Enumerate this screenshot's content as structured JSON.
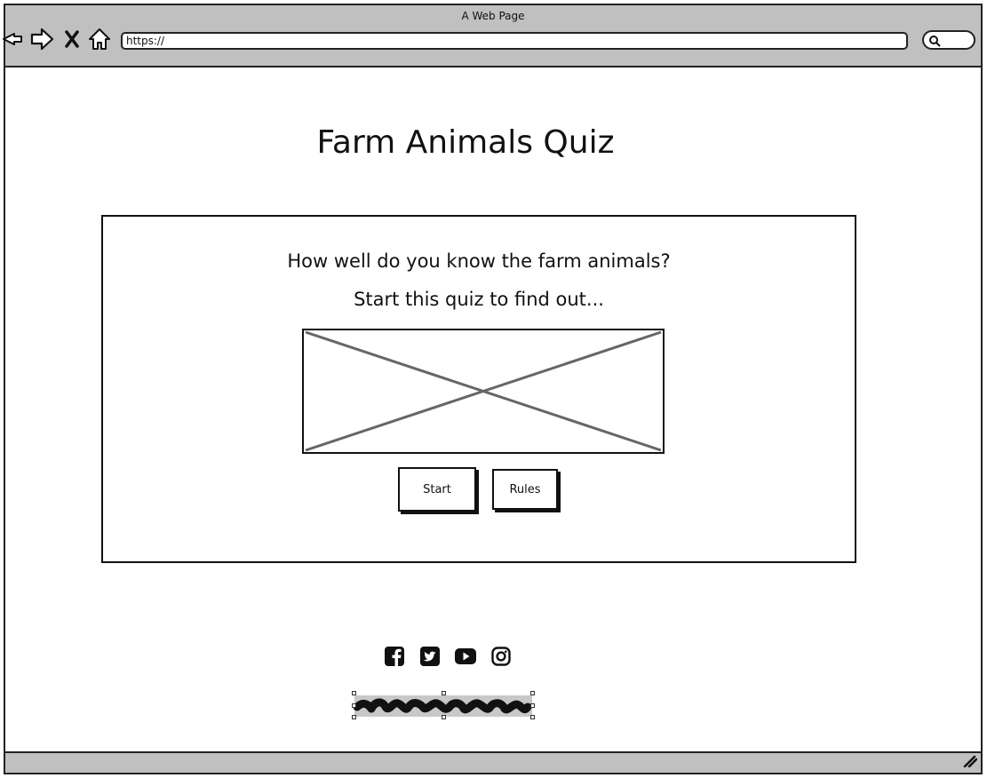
{
  "window": {
    "title": "A Web Page"
  },
  "browser": {
    "url": "https://",
    "icons": [
      "back-arrow-icon",
      "forward-arrow-icon",
      "close-icon",
      "home-icon",
      "search-icon",
      "resize-grip-icon"
    ]
  },
  "page": {
    "title": "Farm Animals Quiz",
    "question": "How well do you know the farm animals?",
    "subtext": "Start this quiz to find out...",
    "image": "image-placeholder",
    "buttons": {
      "start_label": "Start",
      "rules_label": "Rules"
    }
  },
  "footer": {
    "social_icons": [
      "facebook-icon",
      "twitter-icon",
      "youtube-icon",
      "instagram-icon"
    ],
    "signature": "scribble-placeholder"
  },
  "colors": {
    "chrome": "#c0c0c0",
    "ink": "#111111",
    "placeholder_stroke": "#666666"
  }
}
